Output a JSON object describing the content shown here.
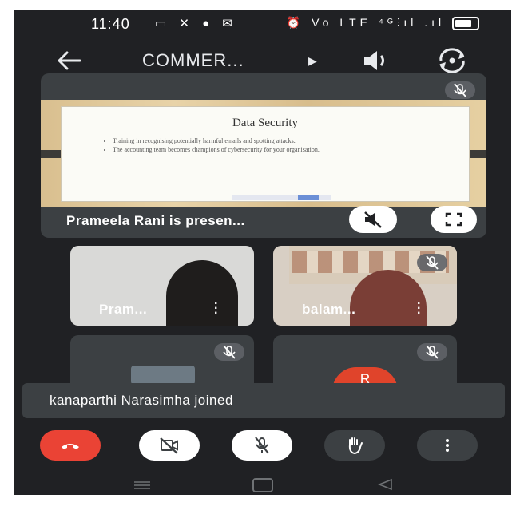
{
  "status_bar": {
    "time": "11:40",
    "left_icons": [
      "cast-icon",
      "tools-icon",
      "person-icon",
      "gmail-icon"
    ],
    "right_icons": [
      "alarm-icon",
      "volte-icon",
      "signal-icon",
      "signal-icon",
      "battery-icon"
    ],
    "right_text": "⏰ Vo LTE ⁴ᴳ⫶ıl .ıl"
  },
  "top_bar": {
    "title": "COMMER...",
    "icons": [
      "back-arrow-icon",
      "play-icon",
      "speaker-icon",
      "switch-camera-icon"
    ]
  },
  "presentation": {
    "slide_title": "Data Security",
    "bullets": [
      "Training in recognising potentially harmful emails and spotting attacks.",
      "The accounting team becomes champions of cybersecurity for your organisation."
    ],
    "caption": "Prameela Rani is presen...",
    "buttons": [
      "mute-icon",
      "fullscreen-icon"
    ]
  },
  "participants": [
    {
      "name": "Pram...",
      "muted": true
    },
    {
      "name": "balam...",
      "muted": true
    },
    {
      "name": "",
      "muted": true
    },
    {
      "name": "",
      "avatar_letter": "R",
      "avatar_color": "#e0442b",
      "muted": true
    }
  ],
  "toast": {
    "text": "kanaparthi Narasimha joined"
  },
  "controls": {
    "end_call_color": "#ea4335",
    "items": [
      "end-call-icon",
      "camera-off-icon",
      "mic-off-icon",
      "raise-hand-icon",
      "more-icon"
    ]
  },
  "nav": [
    "menu-icon",
    "home-icon",
    "back-icon"
  ],
  "colors": {
    "background": "#202124",
    "tile": "#3c4043",
    "accent_red": "#ea4335"
  }
}
